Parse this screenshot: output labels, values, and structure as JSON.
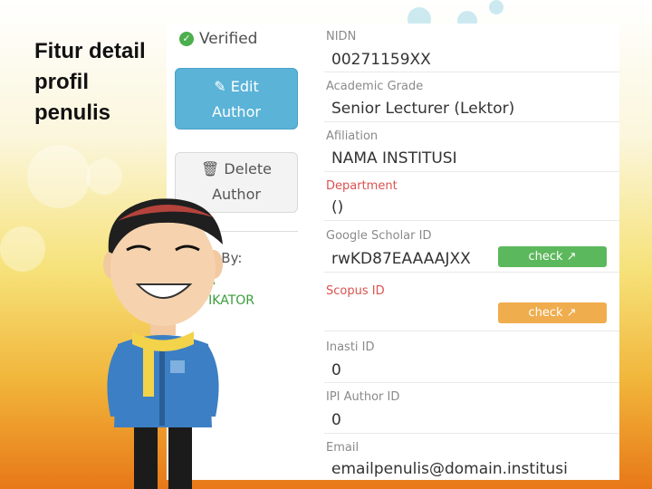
{
  "slide_title": "Fitur detail profil penulis",
  "status": {
    "verified_label": "Verified"
  },
  "actions": {
    "edit_label": "Edit",
    "edit_label2": "Author",
    "delete_label": "Delete",
    "delete_label2": "Author"
  },
  "verified_by": {
    "label": "d By:",
    "line1": "A",
    "line2": "IFIKATOR"
  },
  "fields": {
    "nidn": {
      "label": "NIDN",
      "value": "00271159XX"
    },
    "academic_grade": {
      "label": "Academic Grade",
      "value": "Senior Lecturer (Lektor)"
    },
    "affiliation": {
      "label": "Afiliation",
      "value": "NAMA INSTITUSI"
    },
    "department": {
      "label": "Department",
      "value": "()"
    },
    "google_scholar": {
      "label": "Google Scholar ID",
      "value": "rwKD87EAAAAJXX",
      "button": "check"
    },
    "scopus": {
      "label": "Scopus ID",
      "value": "",
      "button": "check"
    },
    "inasti": {
      "label": "Inasti ID",
      "value": "0"
    },
    "ipi_author": {
      "label": "IPI Author ID",
      "value": "0"
    },
    "email": {
      "label": "Email",
      "value": "emailpenulis@domain.institusi"
    }
  },
  "colors": {
    "edit_button": "#5bb3d7",
    "check_green": "#5cb85c",
    "check_orange": "#f0ad4e",
    "label_red": "#d9534f"
  }
}
